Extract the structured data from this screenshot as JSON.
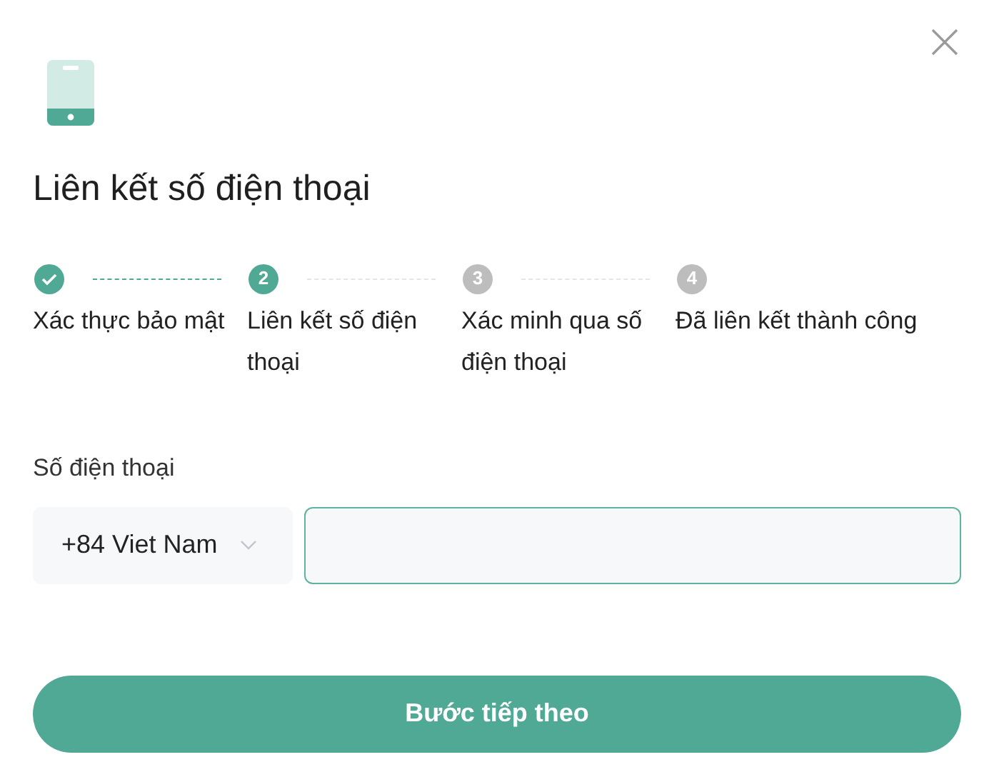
{
  "title": "Liên kết số điện thoại",
  "steps": [
    {
      "kind": "done",
      "label": "Xác thực bảo mật"
    },
    {
      "kind": "current",
      "number": "2",
      "label": "Liên kết số điện thoại"
    },
    {
      "kind": "pending",
      "number": "3",
      "label": "Xác minh qua số điện thoại"
    },
    {
      "kind": "pending",
      "number": "4",
      "label": "Đã liên kết thành công"
    }
  ],
  "phone_label": "Số điện thoại",
  "country": "+84 Viet Nam",
  "next_button": "Bước tiếp theo"
}
